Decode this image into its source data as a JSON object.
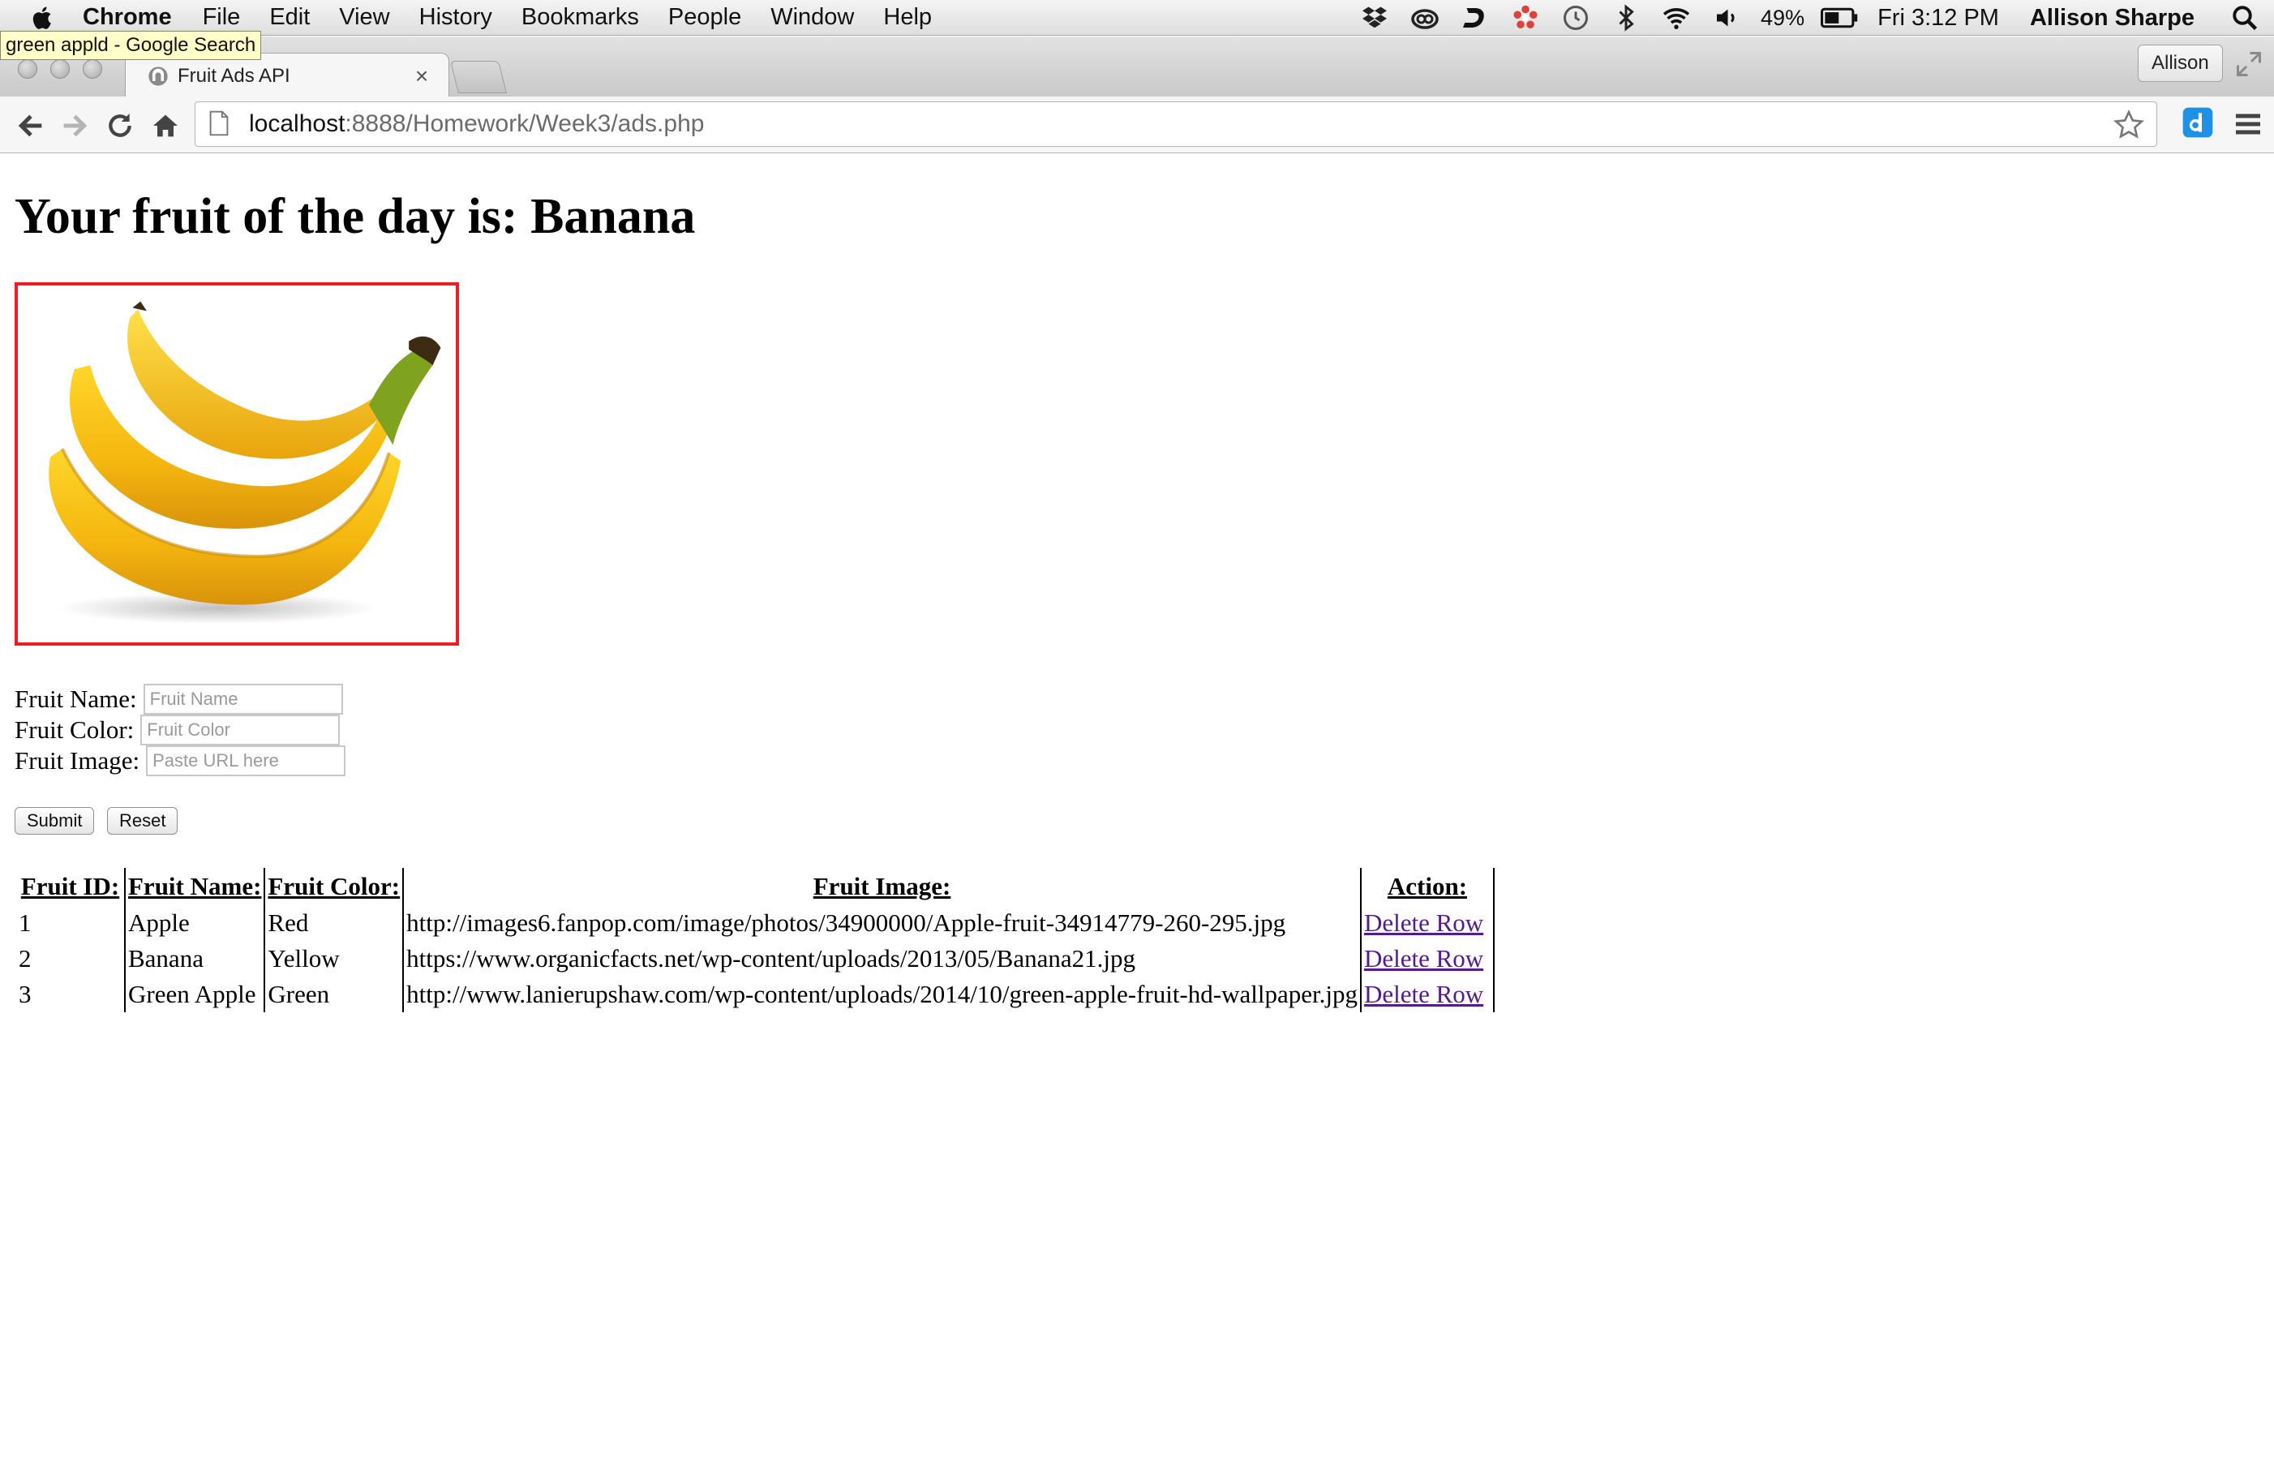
{
  "menubar": {
    "app_name": "Chrome",
    "items": [
      "File",
      "Edit",
      "View",
      "History",
      "Bookmarks",
      "People",
      "Window",
      "Help"
    ],
    "battery": "49%",
    "clock": "Fri 3:12 PM",
    "user": "Allison Sharpe",
    "icons": [
      "apple-icon",
      "dropbox-icon",
      "creative-cloud-icon",
      "d-logo-icon",
      "flower-icon",
      "time-machine-icon",
      "bluetooth-icon",
      "wifi-icon",
      "volume-icon",
      "battery-icon",
      "spotlight-icon"
    ]
  },
  "tooltip": "green appld - Google Search",
  "browser": {
    "tab_title": "Fruit Ads API",
    "profile_name": "Allison",
    "url_host": "localhost",
    "url_rest": ":8888/Homework/Week3/ads.php"
  },
  "page": {
    "heading": "Your fruit of the day is: Banana",
    "image_frame_color": "#ee1c25",
    "form": {
      "name_label": "Fruit Name:",
      "name_placeholder": "Fruit Name",
      "color_label": "Fruit Color:",
      "color_placeholder": "Fruit Color",
      "image_label": "Fruit Image:",
      "image_placeholder": "Paste URL here",
      "submit_label": "Submit",
      "reset_label": "Reset"
    },
    "table": {
      "headers": [
        "Fruit ID:",
        "Fruit Name:",
        "Fruit Color:",
        "Fruit Image:",
        "Action:"
      ],
      "rows": [
        {
          "id": "1",
          "name": "Apple",
          "color": "Red",
          "image": "http://images6.fanpop.com/image/photos/34900000/Apple-fruit-34914779-260-295.jpg",
          "action": "Delete Row"
        },
        {
          "id": "2",
          "name": "Banana",
          "color": "Yellow",
          "image": "https://www.organicfacts.net/wp-content/uploads/2013/05/Banana21.jpg",
          "action": "Delete Row"
        },
        {
          "id": "3",
          "name": "Green Apple",
          "color": "Green",
          "image": "http://www.lanierupshaw.com/wp-content/uploads/2014/10/green-apple-fruit-hd-wallpaper.jpg",
          "action": "Delete Row"
        }
      ]
    }
  }
}
